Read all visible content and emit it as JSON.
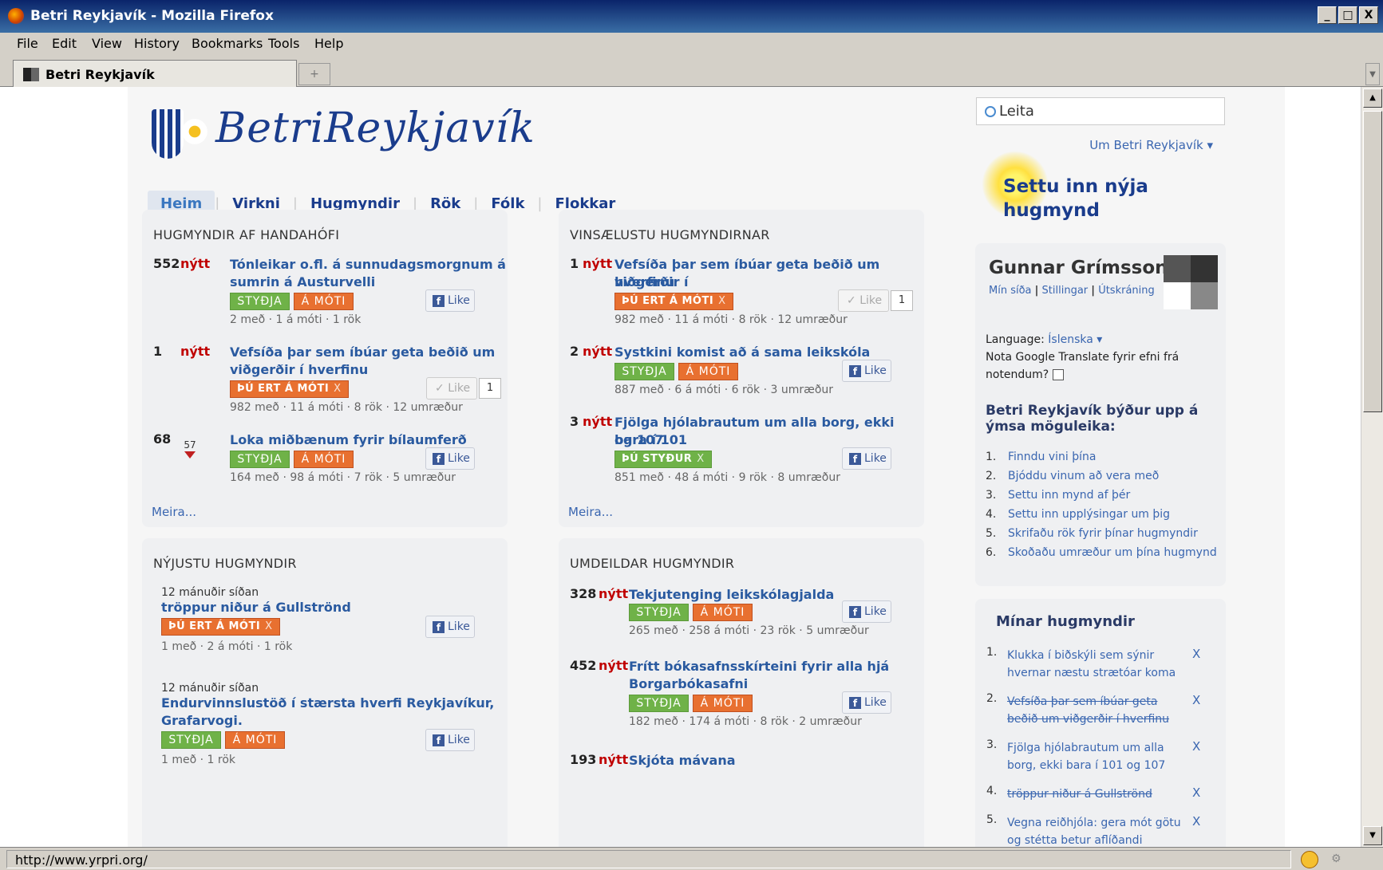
{
  "window": {
    "title": "Betri Reykjavík - Mozilla Firefox",
    "min": "_",
    "max": "□",
    "close": "X"
  },
  "menu": [
    "File",
    "Edit",
    "View",
    "History",
    "Bookmarks",
    "Tools",
    "Help"
  ],
  "tab": {
    "label": "Betri Reykjavík",
    "new_tab": "+"
  },
  "status": {
    "url": "http://www.yrpri.org/"
  },
  "site": {
    "logo_text": "BetriReykjavík",
    "nav": [
      "Heim",
      "Virkni",
      "Hugmyndir",
      "Rök",
      "Fólk",
      "Flokkar"
    ],
    "search_placeholder": "Leita",
    "um": "Um Betri Reykjavík ▾",
    "new_idea": "Settu inn nýja hugmynd"
  },
  "labels": {
    "support": "STYÐJA",
    "oppose": "Á MÓTI",
    "you_oppose": "ÞÚ ERT Á MÓTI",
    "you_support": "ÞÚ STYÐUR",
    "x": "X",
    "like": "Like",
    "new": "nýtt",
    "more": "Meira..."
  },
  "random": {
    "heading": "HUGMYNDIR AF HANDAHÓFI",
    "items": [
      {
        "num": "552",
        "title1": "Tónleikar o.fl. á sunnudagsmorgnum á",
        "title2": "sumrin á Austurvelli",
        "stats": "2 með · 1 á móti · 1 rök"
      },
      {
        "num": "1",
        "title1": "Vefsíða þar sem íbúar geta beðið um",
        "title2": "viðgerðir í hverfinu",
        "stats": "982 með · 11 á móti · 8 rök · 12 umræður",
        "likes": "1"
      },
      {
        "num": "68",
        "down": "57",
        "title1": "Loka miðbænum fyrir bílaumferð",
        "stats": "164 með · 98 á móti · 7 rök · 5 umræður"
      }
    ]
  },
  "popular": {
    "heading": "VINSÆLUSTU HUGMYNDIRNAR",
    "items": [
      {
        "num": "1",
        "title1": "Vefsíða þar sem íbúar geta beðið um viðgerðir í",
        "title2": "hverfinu",
        "stats": "982 með · 11 á móti · 8 rök · 12 umræður",
        "likes": "1"
      },
      {
        "num": "2",
        "title1": "Systkini komist að á sama leikskóla",
        "stats": "887 með · 6 á móti · 6 rök · 3 umræður"
      },
      {
        "num": "3",
        "title1": "Fjölga hjólabrautum um alla borg, ekki bara í 101",
        "title2": "og 107",
        "stats": "851 með · 48 á móti · 9 rök · 8 umræður"
      }
    ]
  },
  "newest": {
    "heading": "NÝJUSTU HUGMYNDIR",
    "items": [
      {
        "when": "12 mánuðir síðan",
        "title1": "tröppur niður á Gullströnd",
        "stats": "1 með · 2 á móti · 1 rök"
      },
      {
        "when": "12 mánuðir síðan",
        "title1": "Endurvinnslustöð í stærsta hverfi Reykjavíkur,",
        "title2": "Grafarvogi.",
        "stats": "1 með · 1 rök"
      }
    ]
  },
  "controversial": {
    "heading": "UMDEILDAR HUGMYNDIR",
    "items": [
      {
        "num": "328",
        "title1": "Tekjutenging leikskólagjalda",
        "stats": "265 með · 258 á móti · 23 rök · 5 umræður"
      },
      {
        "num": "452",
        "title1": "Frítt bókasafnsskírteini fyrir alla hjá",
        "title2": "Borgarbókasafni",
        "stats": "182 með · 174 á móti · 8 rök · 2 umræður"
      },
      {
        "num": "193",
        "title1": "Skjóta mávana"
      }
    ]
  },
  "user": {
    "name": "Gunnar Grímsson",
    "links": [
      "Mín síða",
      "Stillingar",
      "Útskráning"
    ],
    "sep": "|",
    "language_label": "Language:",
    "language_value": "Íslenska ▾",
    "translate": "Nota Google Translate fyrir efni frá notendum?",
    "offer_heading": "Betri Reykjavík býður upp á ýmsa möguleika:",
    "offers": [
      "Finndu vini þína",
      "Bjóddu vinum að vera með",
      "Settu inn mynd af þér",
      "Settu inn upplýsingar um þig",
      "Skrifaðu rök fyrir þínar hugmyndir",
      "Skoðaðu umræður um þína hugmynd"
    ]
  },
  "my_ideas": {
    "heading": "Mínar hugmyndir",
    "items": [
      {
        "n": "1.",
        "line1": "Klukka í biðskýli sem sýnir",
        "line2": "hvernar næstu strætóar koma"
      },
      {
        "n": "2.",
        "line1": "Vefsíða þar sem íbúar geta",
        "line2": "beðið um viðgerðir í hverfinu"
      },
      {
        "n": "3.",
        "line1": "Fjölga hjólabrautum um alla",
        "line2": "borg, ekki bara í 101 og 107"
      },
      {
        "n": "4.",
        "line1": "tröppur niður á Gullströnd"
      },
      {
        "n": "5.",
        "line1": "Vegna reiðhjóla: gera mót götu",
        "line2": "og stétta betur aflíðandi"
      }
    ]
  }
}
